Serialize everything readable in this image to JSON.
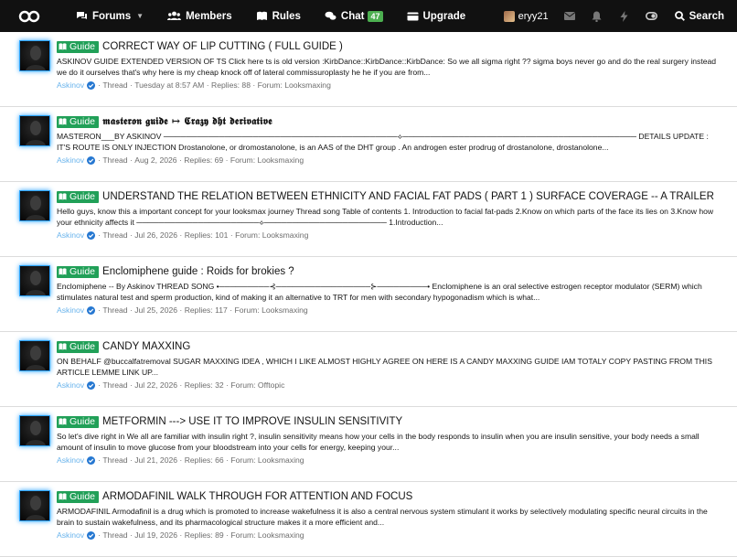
{
  "nav": {
    "forums": "Forums",
    "members": "Members",
    "rules": "Rules",
    "chat": "Chat",
    "chat_count": "47",
    "upgrade": "Upgrade",
    "username": "eryy21",
    "search": "Search"
  },
  "threads": [
    {
      "prefix": "Guide",
      "title": "CORRECT WAY OF LIP CUTTING ( FULL GUIDE )",
      "snippet": "ASKINOV GUIDE EXTENDED VERSION OF TS Click here ts is old version :KirbDance::KirbDance::KirbDance: So we all sigma right ?? sigma boys never go and do the real surgery instead we do it ourselves that's why here is my cheap knock off of lateral commissuroplasty he he if you are from...",
      "author": "Askinov",
      "type": "Thread",
      "date": "Tuesday at 8:57 AM",
      "replies": "Replies: 88",
      "forum": "Forum: Looksmaxing"
    },
    {
      "prefix": "Guide",
      "title": "𝖒𝖆𝖘𝖙𝖊𝖗𝖔𝖓 𝖌𝖚𝖎𝖉𝖊 ↦ 𝕮𝖗𝖆𝖟𝖞 𝖉𝖍𝖙 𝖉𝖊𝖗𝖎𝖛𝖆𝖙𝖎𝖛𝖊",
      "snippet": "MASTERON___BY ASKINOV ──────────────────────────────────────────⟡────────────────────────────────────────── DETAILS UPDATE : IT'S ROUTE IS ONLY INJECTION Drostanolone, or dromostanolone, is an AAS of the DHT group . An androgen ester prodrug of drostanolone, drostanolone...",
      "author": "Askinov",
      "type": "Thread",
      "date": "Aug 2, 2026",
      "replies": "Replies: 69",
      "forum": "Forum: Looksmaxing"
    },
    {
      "prefix": "Guide",
      "title": "UNDERSTAND THE RELATION BETWEEN ETHNICITY AND FACIAL FAT PADS ( PART 1 ) SURFACE COVERAGE -- A TRAILER",
      "snippet": "Hello guys, know this a important concept for your looksmax journey Thread song Table of contents 1. Introduction to facial fat-pads 2.Know on which parts of the face its lies on 3.Know how your ethnicity affects it ──────────────────────⟡────────────────────── 1.Introduction...",
      "author": "Askinov",
      "type": "Thread",
      "date": "Jul 26, 2026",
      "replies": "Replies: 101",
      "forum": "Forum: Looksmaxing"
    },
    {
      "prefix": "Guide",
      "title": "Enclomiphene guide : Roids for brokies ?",
      "snippet": "Enclomiphene -- By Askinov THREAD SONG •─────────⊰─────────────────⊱─────────• Enclomiphene is an oral selective estrogen receptor modulator (SERM) which stimulates natural test and sperm production, kind of making it an alternative to TRT for men with secondary hypogonadism which is what...",
      "author": "Askinov",
      "type": "Thread",
      "date": "Jul 25, 2026",
      "replies": "Replies: 117",
      "forum": "Forum: Looksmaxing"
    },
    {
      "prefix": "Guide",
      "title": "CANDY MAXXING",
      "snippet": "ON BEHALF @buccalfatremoval SUGAR MAXXING IDEA , WHICH I LIKE ALMOST HIGHLY AGREE ON HERE IS A CANDY MAXXING GUIDE IAM TOTALY COPY PASTING FROM THIS ARTICLE LEMME LINK UP...",
      "author": "Askinov",
      "type": "Thread",
      "date": "Jul 22, 2026",
      "replies": "Replies: 32",
      "forum": "Forum: Offtopic"
    },
    {
      "prefix": "Guide",
      "title": "METFORMIN ---> USE IT TO IMPROVE INSULIN SENSITIVITY",
      "snippet": "So let's dive right in We all are familiar with insulin right ?, insulin sensitivity means how your cells in the body responds to insulin when you are insulin sensitive, your body needs a small amount of insulin to move glucose from your bloodstream into your cells for energy, keeping your...",
      "author": "Askinov",
      "type": "Thread",
      "date": "Jul 21, 2026",
      "replies": "Replies: 66",
      "forum": "Forum: Looksmaxing"
    },
    {
      "prefix": "Guide",
      "title": "ARMODAFINIL WALK THROUGH FOR ATTENTION AND FOCUS",
      "snippet": "ARMODAFINIL Armodafinil is a drug which is promoted to increase wakefulness it is also a central nervous system stimulant it works by selectively modulating specific neural circuits in the brain to sustain wakefulness, and its pharmacological structure makes it a more efficient and...",
      "author": "Askinov",
      "type": "Thread",
      "date": "Jul 19, 2026",
      "replies": "Replies: 89",
      "forum": "Forum: Looksmaxing"
    }
  ],
  "colors": {
    "topbar": "#111111",
    "guide_badge": "#21a058",
    "author": "#6ab4ec",
    "avatar_glow": "#2aa3ff",
    "chat_badge": "#4caf50"
  }
}
